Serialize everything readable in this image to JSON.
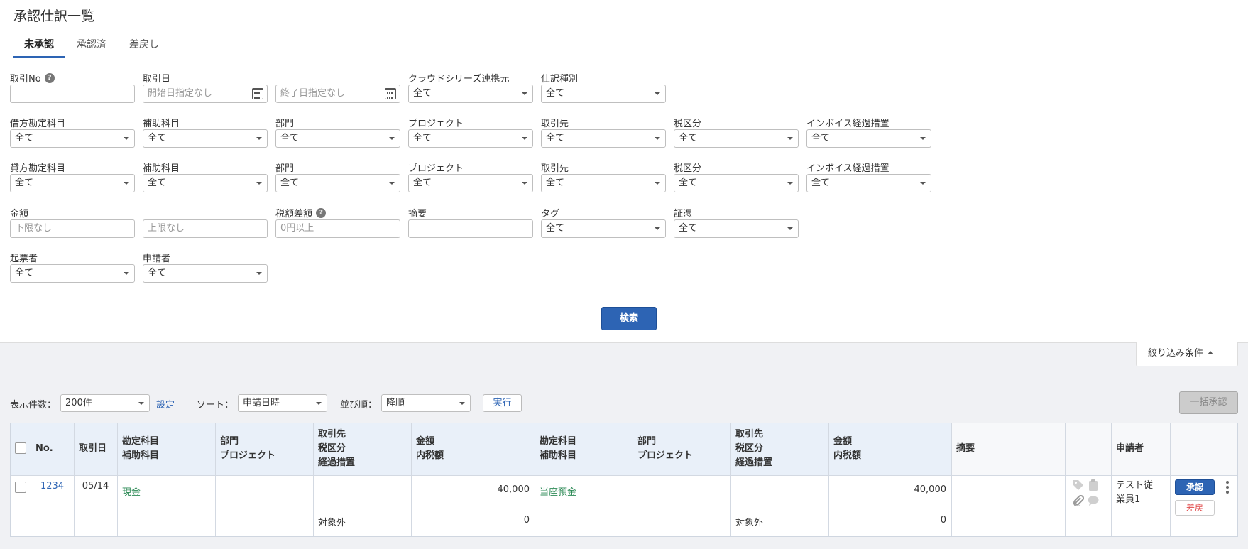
{
  "page": {
    "title": "承認仕訳一覧"
  },
  "tabs": [
    {
      "label": "未承認",
      "active": true
    },
    {
      "label": "承認済",
      "active": false
    },
    {
      "label": "差戻し",
      "active": false
    }
  ],
  "filters": {
    "deal_no": {
      "label": "取引No",
      "value": ""
    },
    "deal_date": {
      "label": "取引日",
      "start_placeholder": "開始日指定なし",
      "end_placeholder": "終了日指定なし"
    },
    "cloud_source": {
      "label": "クラウドシリーズ連携元",
      "value": "全て"
    },
    "journal_type": {
      "label": "仕訳種別",
      "value": "全て"
    },
    "debit": {
      "account": {
        "label": "借方勘定科目",
        "value": "全て"
      },
      "sub_account": {
        "label": "補助科目",
        "value": "全て"
      },
      "department": {
        "label": "部門",
        "value": "全て"
      },
      "project": {
        "label": "プロジェクト",
        "value": "全て"
      },
      "partner": {
        "label": "取引先",
        "value": "全て"
      },
      "tax": {
        "label": "税区分",
        "value": "全て"
      },
      "invoice": {
        "label": "インボイス経過措置",
        "value": "全て"
      }
    },
    "credit": {
      "account": {
        "label": "貸方勘定科目",
        "value": "全て"
      },
      "sub_account": {
        "label": "補助科目",
        "value": "全て"
      },
      "department": {
        "label": "部門",
        "value": "全て"
      },
      "project": {
        "label": "プロジェクト",
        "value": "全て"
      },
      "partner": {
        "label": "取引先",
        "value": "全て"
      },
      "tax": {
        "label": "税区分",
        "value": "全て"
      },
      "invoice": {
        "label": "インボイス経過措置",
        "value": "全て"
      }
    },
    "amount": {
      "label": "金額",
      "min_placeholder": "下限なし",
      "max_placeholder": "上限なし"
    },
    "tax_diff": {
      "label": "税額差額",
      "placeholder": "0円以上"
    },
    "memo": {
      "label": "摘要",
      "value": ""
    },
    "tag": {
      "label": "タグ",
      "value": "全て"
    },
    "voucher": {
      "label": "証憑",
      "value": "全て"
    },
    "creator": {
      "label": "起票者",
      "value": "全て"
    },
    "applicant": {
      "label": "申請者",
      "value": "全て"
    },
    "search_button": "検索",
    "toggle_label": "絞り込み条件"
  },
  "controls": {
    "per_page_label": "表示件数：",
    "per_page_value": "200件",
    "settings_link": "設定",
    "sort_label": "ソート：",
    "sort_value": "申請日時",
    "order_label": "並び順：",
    "order_value": "降順",
    "execute_button": "実行",
    "bulk_approve_button": "一括承認"
  },
  "table": {
    "headers": {
      "no": "No.",
      "date": "取引日",
      "debit_account": [
        "勘定科目",
        "補助科目"
      ],
      "debit_dept": [
        "部門",
        "プロジェクト"
      ],
      "debit_partner": [
        "取引先",
        "税区分",
        "経過措置"
      ],
      "debit_amount": [
        "金額",
        "内税額"
      ],
      "credit_account": [
        "勘定科目",
        "補助科目"
      ],
      "credit_dept": [
        "部門",
        "プロジェクト"
      ],
      "credit_partner": [
        "取引先",
        "税区分",
        "経過措置"
      ],
      "credit_amount": [
        "金額",
        "内税額"
      ],
      "memo": "摘要",
      "applicant": "申請者"
    },
    "rows": [
      {
        "no": "1234",
        "date": "05/14",
        "debit_account": "現金",
        "debit_tax": "対象外",
        "debit_amount": "40,000",
        "debit_tax_amount": "0",
        "credit_account": "当座預金",
        "credit_tax": "対象外",
        "credit_amount": "40,000",
        "credit_tax_amount": "0",
        "applicant": "テスト従\n業員1",
        "approve_label": "承認",
        "reject_label": "差戻"
      }
    ]
  }
}
